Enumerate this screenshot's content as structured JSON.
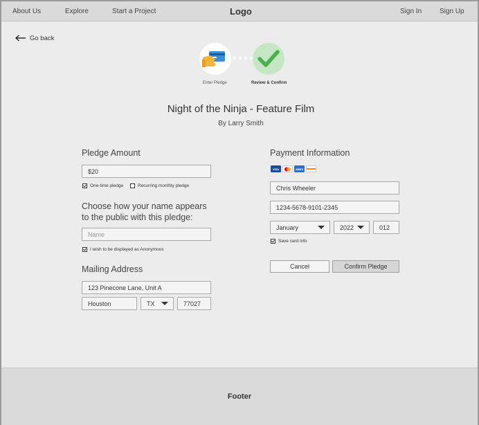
{
  "nav": {
    "about": "About Us",
    "explore": "Explore",
    "start": "Start a Project",
    "logo": "Logo",
    "sign_in": "Sign In",
    "sign_up": "Sign Up"
  },
  "goback": {
    "label": "Go back"
  },
  "steps": {
    "step1_label": "Enter Pledge",
    "step2_label": "Review & Confirm",
    "step2_color": "#c6e7c3",
    "check_color": "#4caf50"
  },
  "project": {
    "title": "Night of the Ninja - Feature Film",
    "byline": "By Larry Smith"
  },
  "pledge": {
    "heading": "Pledge Amount",
    "amount": "$20",
    "one_time_label": "One-time pledge",
    "one_time_checked": true,
    "recurring_label": "Recurring monthly pledge",
    "recurring_checked": false
  },
  "name_section": {
    "heading_line1": "Choose how your name appears",
    "heading_line2": "to the public with this pledge:",
    "name_placeholder": "Name",
    "anonymous_label": "I wish to be displayed as Anonymous",
    "anonymous_checked": true
  },
  "mailing": {
    "heading": "Mailing Address",
    "street": "123 Pinecone Lane, Unit A",
    "city": "Houston",
    "state": "TX",
    "zip": "77027"
  },
  "payment": {
    "heading": "Payment Information",
    "cards": [
      {
        "name": "VISA",
        "color": "#1a4fa0"
      },
      {
        "name": "MC",
        "color": "#ffffff"
      },
      {
        "name": "AMEX",
        "color": "#2a6fc9"
      },
      {
        "name": "DISCOVER",
        "color": "#ffffff"
      }
    ],
    "cardholder": "Chris Wheeler",
    "card_number": "1234-5678-9101-2345",
    "exp_month": "January",
    "exp_year": "2022",
    "cvv": "012",
    "save_label": "Save card info",
    "save_checked": true,
    "cancel_label": "Cancel",
    "confirm_label": "Confirm Pledge"
  },
  "footer": {
    "label": "Footer"
  }
}
